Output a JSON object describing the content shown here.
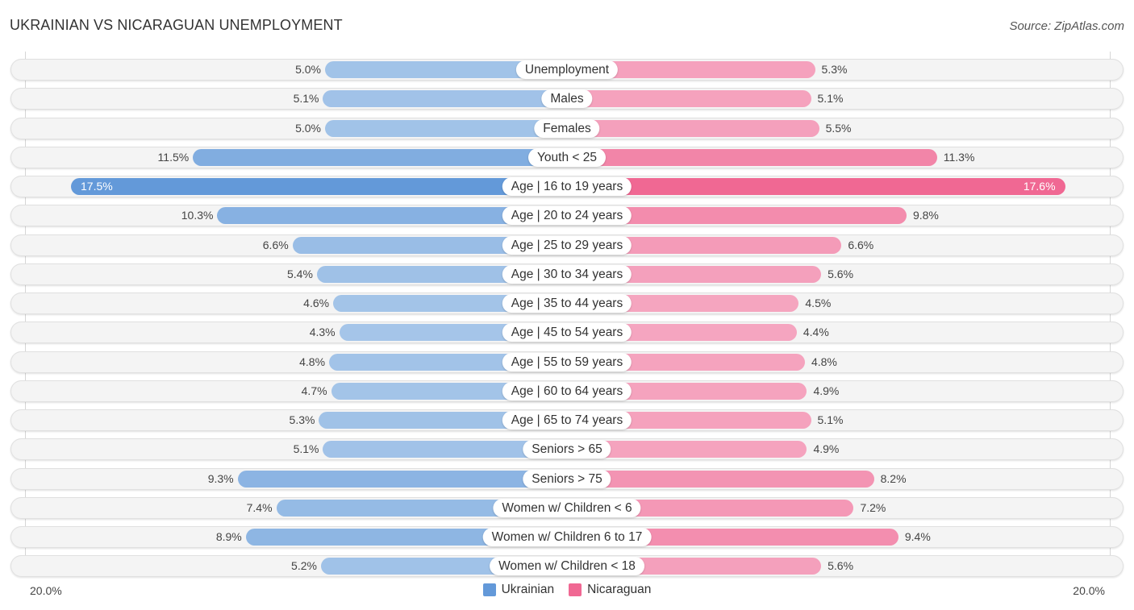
{
  "header": {
    "title": "UKRAINIAN VS NICARAGUAN UNEMPLOYMENT",
    "source": "Source: ZipAtlas.com"
  },
  "colors": {
    "ukrainian_strong": "#6399d9",
    "ukrainian_light": "#a6c6e9",
    "nicaraguan_strong": "#f06893",
    "nicaraguan_light": "#f5a7c1"
  },
  "chart_data": {
    "type": "bar",
    "orientation": "horizontal-diverging",
    "title": "UKRAINIAN VS NICARAGUAN UNEMPLOYMENT",
    "xlabel": "",
    "ylabel": "",
    "xlim": [
      -20.0,
      20.0
    ],
    "axis_tick_labels": {
      "left": "20.0%",
      "right": "20.0%"
    },
    "legend": {
      "position": "bottom-center",
      "entries": [
        "Ukrainian",
        "Nicaraguan"
      ]
    },
    "categories": [
      "Unemployment",
      "Males",
      "Females",
      "Youth < 25",
      "Age | 16 to 19 years",
      "Age | 20 to 24 years",
      "Age | 25 to 29 years",
      "Age | 30 to 34 years",
      "Age | 35 to 44 years",
      "Age | 45 to 54 years",
      "Age | 55 to 59 years",
      "Age | 60 to 64 years",
      "Age | 65 to 74 years",
      "Seniors > 65",
      "Seniors > 75",
      "Women w/ Children < 6",
      "Women w/ Children 6 to 17",
      "Women w/ Children < 18"
    ],
    "series": [
      {
        "name": "Ukrainian",
        "side": "left",
        "values": [
          5.0,
          5.1,
          5.0,
          11.5,
          17.5,
          10.3,
          6.6,
          5.4,
          4.6,
          4.3,
          4.8,
          4.7,
          5.3,
          5.1,
          9.3,
          7.4,
          8.9,
          5.2
        ],
        "labels": [
          "5.0%",
          "5.1%",
          "5.0%",
          "11.5%",
          "17.5%",
          "10.3%",
          "6.6%",
          "5.4%",
          "4.6%",
          "4.3%",
          "4.8%",
          "4.7%",
          "5.3%",
          "5.1%",
          "9.3%",
          "7.4%",
          "8.9%",
          "5.2%"
        ]
      },
      {
        "name": "Nicaraguan",
        "side": "right",
        "values": [
          5.3,
          5.1,
          5.5,
          11.3,
          17.6,
          9.8,
          6.6,
          5.6,
          4.5,
          4.4,
          4.8,
          4.9,
          5.1,
          4.9,
          8.2,
          7.2,
          9.4,
          5.6
        ],
        "labels": [
          "5.3%",
          "5.1%",
          "5.5%",
          "11.3%",
          "17.6%",
          "9.8%",
          "6.6%",
          "5.6%",
          "4.5%",
          "4.4%",
          "4.8%",
          "4.9%",
          "5.1%",
          "4.9%",
          "8.2%",
          "7.2%",
          "9.4%",
          "5.6%"
        ]
      }
    ]
  }
}
